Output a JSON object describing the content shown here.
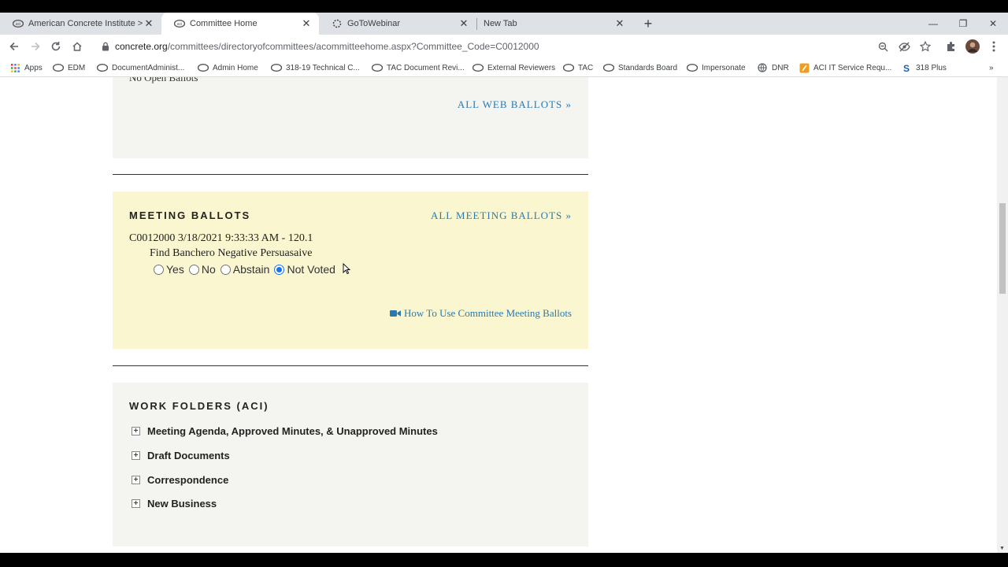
{
  "browser": {
    "tabs": [
      {
        "title": "American Concrete Institute > Ac",
        "icon": "aci-favicon",
        "active": false
      },
      {
        "title": "Committee Home",
        "icon": "aci-favicon",
        "active": true
      },
      {
        "title": "GoToWebinar",
        "icon": "gotowebinar-icon",
        "active": false
      },
      {
        "title": "New Tab",
        "icon": "",
        "active": false
      }
    ],
    "new_tab_label": "+",
    "url_host": "concrete.org",
    "url_path": "/committees/directoryofcommittees/acommitteehome.aspx?Committee_Code=C0012000",
    "window_controls": {
      "minimize": "—",
      "restore": "❐",
      "close": "✕"
    },
    "bookmarks": [
      {
        "label": "Apps",
        "icon": "apps-grid-icon"
      },
      {
        "label": "EDM",
        "icon": "aci-favicon"
      },
      {
        "label": "DocumentAdminist...",
        "icon": "aci-favicon"
      },
      {
        "label": "Admin Home",
        "icon": "aci-favicon"
      },
      {
        "label": "318-19 Technical C...",
        "icon": "aci-favicon"
      },
      {
        "label": "TAC Document Revi...",
        "icon": "aci-favicon"
      },
      {
        "label": "External Reviewers",
        "icon": "aci-favicon"
      },
      {
        "label": "TAC",
        "icon": "aci-favicon"
      },
      {
        "label": "Standards Board",
        "icon": "aci-favicon"
      },
      {
        "label": "Impersonate",
        "icon": "aci-favicon"
      },
      {
        "label": "DNR",
        "icon": "globe-icon"
      },
      {
        "label": "ACI IT Service Requ...",
        "icon": "service-request-icon"
      },
      {
        "label": "318 Plus",
        "icon": "s-icon"
      }
    ],
    "bookmarks_overflow": "»"
  },
  "page": {
    "web_ballots": {
      "cut_text": "No Open Ballots",
      "link": "ALL WEB BALLOTS »"
    },
    "meeting_ballots": {
      "title": "MEETING BALLOTS",
      "link": "ALL MEETING BALLOTS »",
      "ballot_line": "C0012000 3/18/2021 9:33:33 AM - 120.1",
      "question": "Find Banchero Negative Persuasaive",
      "options": [
        "Yes",
        "No",
        "Abstain",
        "Not Voted"
      ],
      "selected": "Not Voted",
      "howto_link": "How To Use Committee Meeting Ballots"
    },
    "work_folders": {
      "title": "WORK FOLDERS (ACI)",
      "items": [
        {
          "label": "Meeting Agenda, Approved Minutes, & Unapproved Minutes"
        },
        {
          "label": "Draft Documents"
        },
        {
          "label": "Correspondence"
        },
        {
          "label": "New Business"
        }
      ]
    }
  },
  "colors": {
    "link": "#2a7ab0",
    "meeting_panel_bg": "#faf6cf",
    "panel_bg": "#f4f4f0"
  }
}
